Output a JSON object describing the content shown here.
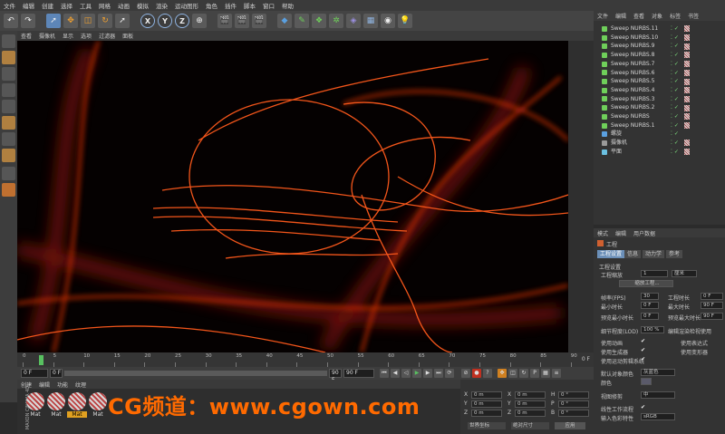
{
  "menu": [
    "文件",
    "编辑",
    "创建",
    "选择",
    "工具",
    "网格",
    "动画",
    "模拟",
    "渲染",
    "运动图形",
    "角色",
    "插件",
    "脚本",
    "窗口",
    "帮助"
  ],
  "viewport": {
    "menu": [
      "查看",
      "摄像机",
      "显示",
      "选项",
      "过滤器",
      "面板"
    ]
  },
  "timeline": {
    "ticks": [
      "0",
      "5",
      "10",
      "15",
      "20",
      "25",
      "30",
      "35",
      "40",
      "45",
      "50",
      "55",
      "60",
      "65",
      "70",
      "75",
      "80",
      "85",
      "90"
    ],
    "end_label": "0 F",
    "current_frame": "0 F",
    "start_field": "0 F",
    "end_field": "90 F",
    "preview_end": "90 F"
  },
  "materials": {
    "menu": [
      "创建",
      "编辑",
      "功能",
      "纹理"
    ],
    "items": [
      {
        "label": "Mat",
        "selected": false
      },
      {
        "label": "Mat",
        "selected": false
      },
      {
        "label": "Mat",
        "selected": true
      },
      {
        "label": "Mat",
        "selected": false
      }
    ],
    "watermark": "CG频道：www.cgown.com",
    "brand": "MAXON CINEMA 4D"
  },
  "coords": {
    "rows": [
      {
        "a": "X",
        "v1": "0 m",
        "b": "X",
        "v2": "0 m",
        "c": "H",
        "v3": "0 °"
      },
      {
        "a": "Y",
        "v1": "0 m",
        "b": "Y",
        "v2": "0 m",
        "c": "P",
        "v3": "0 °"
      },
      {
        "a": "Z",
        "v1": "0 m",
        "b": "Z",
        "v2": "0 m",
        "c": "B",
        "v3": "0 °"
      }
    ],
    "mode1": "世界坐标",
    "mode2": "绝对尺寸",
    "apply": "应用"
  },
  "object_manager": {
    "menu": [
      "文件",
      "编辑",
      "查看",
      "对象",
      "标签",
      "书签"
    ],
    "objects": [
      "Sweep NURBS.11",
      "Sweep NURBS.10",
      "Sweep NURBS.9",
      "Sweep NURBS.8",
      "Sweep NURBS.7",
      "Sweep NURBS.6",
      "Sweep NURBS.5",
      "Sweep NURBS.4",
      "Sweep NURBS.3",
      "Sweep NURBS.2",
      "Sweep NURBS",
      "Sweep NURBS.1",
      "螺旋",
      "摄像机",
      "平面"
    ]
  },
  "attributes": {
    "menu": [
      "模式",
      "编辑",
      "用户数据"
    ],
    "title": "工程",
    "tabs": [
      "工程设置",
      "信息",
      "动力学",
      "参考"
    ],
    "section": "工程设置",
    "fields": [
      {
        "label": "工程缩放",
        "value": "1",
        "unit": "厘米"
      },
      {
        "label": "帧率(FPS)",
        "value": "30",
        "label2": "工程时长",
        "value2": "0 F"
      },
      {
        "label": "最小时长",
        "value": "0 F",
        "label2": "最大时长",
        "value2": "90 F"
      },
      {
        "label": "预览最小时长",
        "value": "0 F",
        "label2": "预览最大时长",
        "value2": "90 F"
      },
      {
        "label": "细节程度(LOD)",
        "value": "100 %",
        "label2": "编辑渲染检视使用",
        "value2": ""
      }
    ],
    "scale_button": "缩放工程...",
    "checks": [
      {
        "label": "使用动画",
        "label2": "使用表达式"
      },
      {
        "label": "使用生成器",
        "label2": "使用变形器"
      },
      {
        "label": "使用运动剪辑系统",
        "label2": ""
      }
    ],
    "default_color_label": "默认对象颜色",
    "default_color_value": "灰蓝色",
    "color_label": "颜色",
    "view_clip_label": "视图修剪",
    "view_clip_value": "中",
    "linear_label": "线性工作流程",
    "input_color_label": "输入色彩特性",
    "input_color_value": "sRGB"
  }
}
